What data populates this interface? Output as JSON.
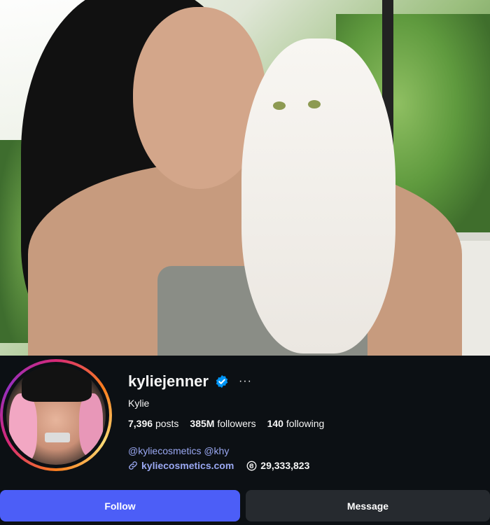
{
  "profile": {
    "username": "kyliejenner",
    "more_label": "···",
    "full_name": "Kylie",
    "stats": {
      "posts_count": "7,396",
      "posts_label": "posts",
      "followers_count": "385M",
      "followers_label": "followers",
      "following_count": "140",
      "following_label": "following"
    },
    "bio_links": "@kyliecosmetics @khy",
    "website": "kyliecosmetics.com",
    "threads_count": "29,333,823"
  },
  "actions": {
    "follow_label": "Follow",
    "message_label": "Message"
  },
  "colors": {
    "background": "#0c1014",
    "follow_button": "#4c5ef7",
    "message_button": "#262a2f",
    "link": "#9aa8f2",
    "verified": "#0095f6"
  },
  "icons": [
    "verified-badge-icon",
    "more-options-icon",
    "link-icon",
    "threads-icon"
  ]
}
